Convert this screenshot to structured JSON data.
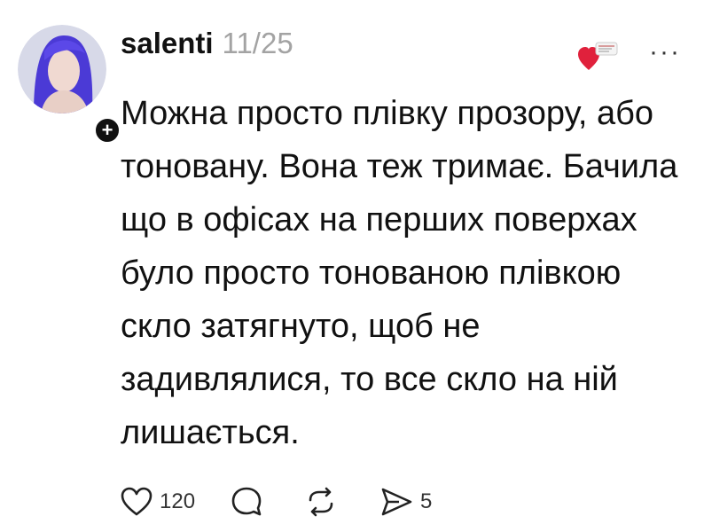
{
  "post": {
    "username": "salenti",
    "date": "11/25",
    "more_label": "···",
    "follow_label": "+",
    "text": "Можна просто плівку прозору, або тоновану. Вона теж тримає. Бачила що в офісах на перших поверхах було просто тонованою плівкою скло затягнуто, щоб не задивлялися, то все скло на ній лишається.",
    "likes": "120",
    "comments": "",
    "reposts": "",
    "shares": "5"
  },
  "icons": {
    "avatar": "user-avatar-photo",
    "follow": "plus-icon",
    "heart_badge": "heart-icon",
    "more": "more-dots-icon",
    "like": "heart-outline-icon",
    "comment": "comment-icon",
    "repost": "repost-icon",
    "share": "send-icon"
  },
  "colors": {
    "text": "#111111",
    "muted": "#a3a3a3",
    "badge_heart": "#e0213c",
    "avatar_hair": "#4b3ad6"
  }
}
